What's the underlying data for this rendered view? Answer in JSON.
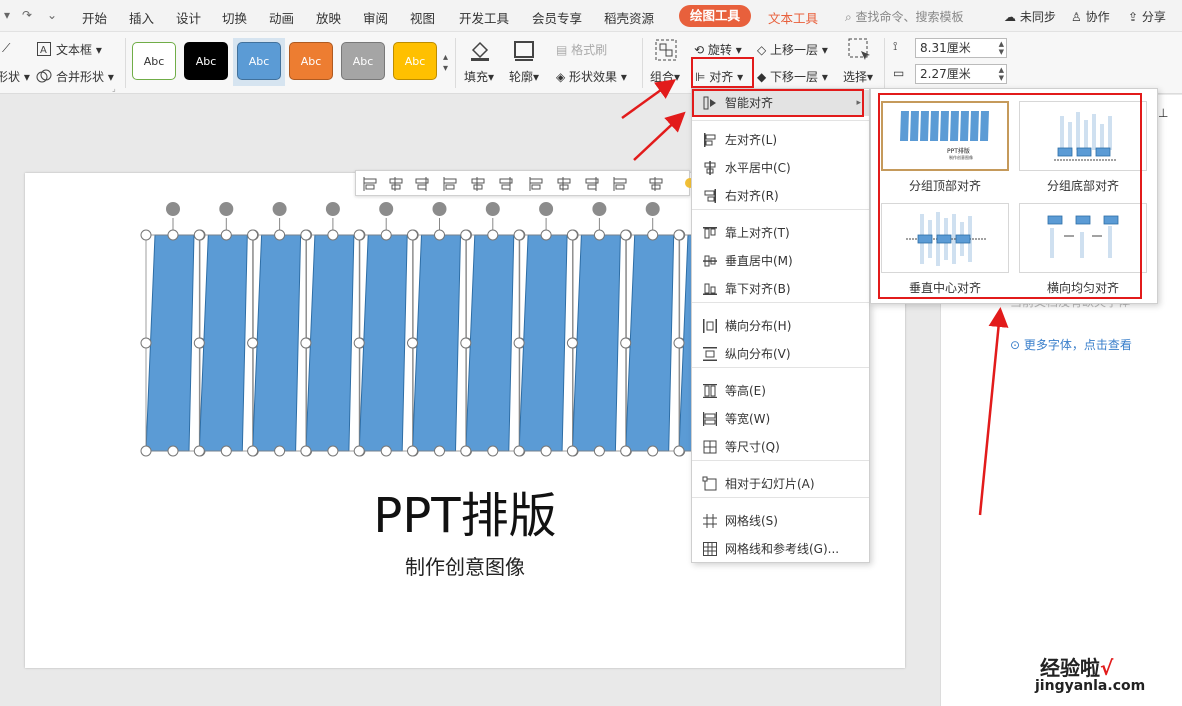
{
  "menubar": {
    "tabs": [
      "开始",
      "插入",
      "设计",
      "切换",
      "动画",
      "放映",
      "审阅",
      "视图",
      "开发工具",
      "会员专享",
      "稻壳资源"
    ],
    "active_tool_tab": "绘图工具",
    "text_tool_tab": "文本工具",
    "search_placeholder": "查找命令、搜索模板",
    "sync": "未同步",
    "collab": "协作",
    "share": "分享"
  },
  "ribbon": {
    "shape_partial": "形状",
    "textbox": "文本框",
    "merge_shape": "合并形状",
    "styles": [
      {
        "label": "Abc",
        "bg": "#ffffff",
        "fg": "#333333",
        "border": "#70ad47"
      },
      {
        "label": "Abc",
        "bg": "#000000",
        "fg": "#ffffff",
        "border": "#000000"
      },
      {
        "label": "Abc",
        "bg": "#5b9bd5",
        "fg": "#ffffff",
        "border": "#41719c"
      },
      {
        "label": "Abc",
        "bg": "#ed7d31",
        "fg": "#ffffff",
        "border": "#ae5a21"
      },
      {
        "label": "Abc",
        "bg": "#a5a5a5",
        "fg": "#ffffff",
        "border": "#787878"
      },
      {
        "label": "Abc",
        "bg": "#ffc000",
        "fg": "#ffffff",
        "border": "#bc8c00"
      }
    ],
    "fill": "填充",
    "outline": "轮廓",
    "format_painter": "格式刷",
    "shape_effect": "形状效果",
    "group": "组合",
    "rotate": "旋转",
    "align": "对齐",
    "bring_forward": "上移一层",
    "send_backward": "下移一层",
    "select": "选择",
    "height": "8.31厘米",
    "width": "2.27厘米"
  },
  "slide": {
    "title": "PPT排版",
    "subtitle": "制作创意图像",
    "bar_color": "#5b9bd5",
    "bar_count": 11
  },
  "align_menu": {
    "smart_align": "智能对齐",
    "items": [
      "左对齐(L)",
      "水平居中(C)",
      "右对齐(R)",
      "靠上对齐(T)",
      "垂直居中(M)",
      "靠下对齐(B)",
      "横向分布(H)",
      "纵向分布(V)",
      "等高(E)",
      "等宽(W)",
      "等尺寸(Q)",
      "相对于幻灯片(A)",
      "网格线(S)",
      "网格线和参考线(G)..."
    ]
  },
  "smart_submenu": {
    "options": [
      "分组顶部对齐",
      "分组底部对齐",
      "垂直中心对齐",
      "横向均匀对齐"
    ],
    "thumb_title": "PPT排版",
    "thumb_subtitle": "制作创意图像"
  },
  "right_panel": {
    "partial_text": "当前文档没有缺失字体",
    "more_fonts": "更多字体，点击查看"
  },
  "watermark": {
    "brand": "经验啦",
    "check": "√",
    "url": "jingyanla.com"
  },
  "colors": {
    "accent": "#e8603c",
    "annotation_red": "#e21b1b",
    "link_blue": "#3a7fcb"
  }
}
